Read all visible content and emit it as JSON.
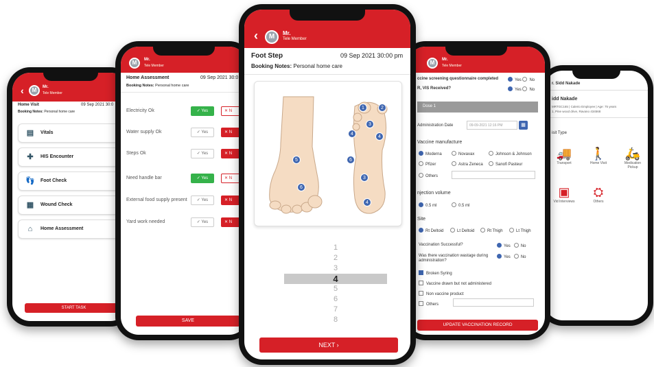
{
  "user": {
    "name_short": "Mr.",
    "name_long": "Mr.",
    "role": "Tele Member",
    "avatar_letter": "M"
  },
  "phone1": {
    "title": "Home Visit",
    "date": "09 Sep 2021 30:0",
    "booking_label": "Booking Notes:",
    "booking_value": "Personal home care",
    "items": [
      {
        "label": "Vitals",
        "icon": "vitals-icon",
        "glyph": "▤",
        "status_color": "#35b24a"
      },
      {
        "label": "HIS Encounter",
        "icon": "encounter-icon",
        "glyph": "✚",
        "status_color": "#d62027"
      },
      {
        "label": "Foot Check",
        "icon": "feet-icon",
        "glyph": "👣",
        "status_color": "#35b24a"
      },
      {
        "label": "Wound Check",
        "icon": "wound-icon",
        "glyph": "▦",
        "status_color": "#d62027"
      },
      {
        "label": "Home Assessment",
        "icon": "home-icon",
        "glyph": "⌂",
        "status_color": "#d62027"
      }
    ],
    "start_button": "START TASK"
  },
  "phone2": {
    "title": "Home Assessment",
    "date": "09 Sep 2021 30:0",
    "booking_label": "Booking Notes:",
    "booking_value": "Personal home care",
    "yes_label": "Yes",
    "no_label": "N",
    "rows": [
      {
        "label": "Electricity Ok",
        "yes_on": true,
        "no_on": false
      },
      {
        "label": "Water supply Ok",
        "yes_on": false,
        "no_on": true
      },
      {
        "label": "Steps Ok",
        "yes_on": false,
        "no_on": true
      },
      {
        "label": "Need handle bar",
        "yes_on": true,
        "no_on": false
      },
      {
        "label": "External food supply present",
        "yes_on": false,
        "no_on": true
      },
      {
        "label": "Yard work needed",
        "yes_on": false,
        "no_on": true
      }
    ],
    "save_button": "SAVE"
  },
  "phone3": {
    "title": "Foot Step",
    "date": "09 Sep 2021 30:00 pm",
    "booking_label": "Booking Notes:",
    "booking_value": "Personal home care",
    "top_markers": [
      "5",
      "6"
    ],
    "sole_markers": [
      "1",
      "2",
      "3",
      "4",
      "4",
      "6",
      "3",
      "4"
    ],
    "picker": [
      "1",
      "2",
      "3",
      "4",
      "5",
      "6",
      "7",
      "8"
    ],
    "picker_selected": "4",
    "next_button": "NEXT ›"
  },
  "phone4": {
    "q1": "ccine screening questionnaire completed",
    "q2": "R, VIS Received?",
    "yes": "Yes",
    "no": "No",
    "section": "Dose 1",
    "admin_date_label": "Administration Date",
    "admin_date_value": "09-09-2021 12:16 PM",
    "manufacturer_label": "Vaccine manufacture",
    "manufacturers": [
      "Moderna",
      "Novavax",
      "Johnson & Johnson",
      "Pfizer",
      "Astra Zeneca",
      "Sanofi Pasteur",
      "Others"
    ],
    "volume_label": "njection volume",
    "volumes": [
      "0.5 ml",
      "0.5 ml"
    ],
    "site_label": "Site",
    "sites": [
      "Rt Deltoid",
      "Lt Deltoid",
      "Rt Thigh",
      "Lt Thigh"
    ],
    "success_q": "Vaccination Successful?",
    "wastage_q1": "Was there vaccination wastage during",
    "wastage_q2": "administration?",
    "reasons": [
      "Broken Syring",
      "Vaccine drawn but not administered",
      "Non vaccine product",
      "Others"
    ],
    "update_button": "UPDATE VACCINATION RECORD"
  },
  "phone5": {
    "top_name": "r. Sidd Nakade",
    "name": "idd Nakade",
    "detail1": "MRTGC165 | Calerio Employee | Age: 75 years",
    "detail2": "1, Pine wood drive, Ravano 434568",
    "visit_type_label": "isit Type",
    "services": [
      {
        "label": "Transport",
        "icon": "transport-icon",
        "glyph": "🚚"
      },
      {
        "label": "Home Visit",
        "icon": "home-visit-icon",
        "glyph": "🚶"
      },
      {
        "label": "Medication Pickup",
        "icon": "scooter-icon",
        "glyph": "🛵"
      },
      {
        "label": "Vid Interviews",
        "icon": "video-icon",
        "glyph": "▣"
      },
      {
        "label": "Others",
        "icon": "others-icon",
        "glyph": "⛭"
      }
    ]
  }
}
